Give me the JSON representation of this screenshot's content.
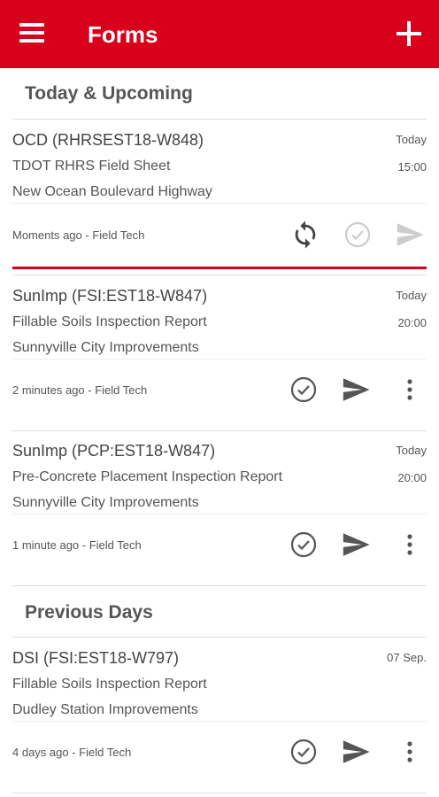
{
  "appbar": {
    "title": "Forms",
    "menu_icon": "menu-icon",
    "add_icon": "plus-icon",
    "color": "#d8001b"
  },
  "sections": {
    "upcoming": "Today & Upcoming",
    "previous": "Previous Days"
  },
  "cards": [
    {
      "title": "OCD (RHRSEST18-W848)",
      "form": "TDOT RHRS Field Sheet",
      "project": "New Ocean Boulevard Highway",
      "day": "Today",
      "time": "15:00",
      "meta": "Moments ago - Field Tech",
      "status": "syncing",
      "icons": [
        "sync-icon",
        "check-circle-icon",
        "send-icon"
      ]
    },
    {
      "title": "SunImp (FSI:EST18-W847)",
      "form": "Fillable Soils Inspection Report",
      "project": "Sunnyville City Improvements",
      "day": "Today",
      "time": "20:00",
      "meta": "2 minutes ago - Field Tech",
      "icons": [
        "check-circle-icon",
        "send-icon",
        "more-vertical-icon"
      ]
    },
    {
      "title": "SunImp (PCP:EST18-W847)",
      "form": "Pre-Concrete Placement Inspection Report",
      "project": "Sunnyville City Improvements",
      "day": "Today",
      "time": "20:00",
      "meta": "1 minute ago - Field Tech",
      "icons": [
        "check-circle-icon",
        "send-icon",
        "more-vertical-icon"
      ]
    },
    {
      "title": "DSI (FSI:EST18-W797)",
      "form": "Fillable Soils Inspection Report",
      "project": "Dudley Station Improvements",
      "day": "07 Sep.",
      "time": "",
      "meta": "4 days ago - Field Tech",
      "icons": [
        "check-circle-icon",
        "send-icon",
        "more-vertical-icon"
      ]
    }
  ]
}
